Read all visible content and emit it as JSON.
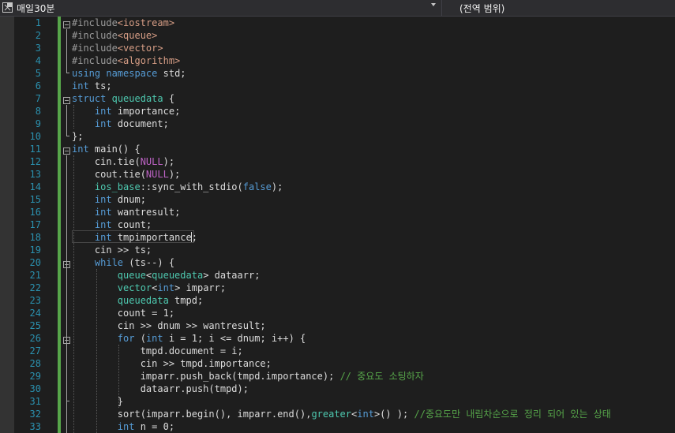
{
  "navbar": {
    "project_name": "매일30분",
    "scope_label": "(전역 범위)"
  },
  "editor": {
    "lines": [
      {
        "n": "1",
        "t": "#include<iostream>"
      },
      {
        "n": "2",
        "t": "#include<queue>"
      },
      {
        "n": "3",
        "t": "#include<vector>"
      },
      {
        "n": "4",
        "t": "#include<algorithm>"
      },
      {
        "n": "5",
        "t": "using namespace std;"
      },
      {
        "n": "6",
        "t": "int ts;"
      },
      {
        "n": "7",
        "t": "struct queuedata {"
      },
      {
        "n": "8",
        "t": "    int importance;"
      },
      {
        "n": "9",
        "t": "    int document;"
      },
      {
        "n": "10",
        "t": "};"
      },
      {
        "n": "11",
        "t": "int main() {"
      },
      {
        "n": "12",
        "t": "    cin.tie(NULL);"
      },
      {
        "n": "13",
        "t": "    cout.tie(NULL);"
      },
      {
        "n": "14",
        "t": "    ios_base::sync_with_stdio(false);"
      },
      {
        "n": "15",
        "t": "    int dnum;"
      },
      {
        "n": "16",
        "t": "    int wantresult;"
      },
      {
        "n": "17",
        "t": "    int count;"
      },
      {
        "n": "18",
        "t": "    int tmpimportance;"
      },
      {
        "n": "19",
        "t": "    cin >> ts;"
      },
      {
        "n": "20",
        "t": "    while (ts--) {"
      },
      {
        "n": "21",
        "t": "        queue<queuedata> dataarr;"
      },
      {
        "n": "22",
        "t": "        vector<int> imparr;"
      },
      {
        "n": "23",
        "t": "        queuedata tmpd;"
      },
      {
        "n": "24",
        "t": "        count = 1;"
      },
      {
        "n": "25",
        "t": "        cin >> dnum >> wantresult;"
      },
      {
        "n": "26",
        "t": "        for (int i = 1; i <= dnum; i++) {"
      },
      {
        "n": "27",
        "t": "            tmpd.document = i;"
      },
      {
        "n": "28",
        "t": "            cin >> tmpd.importance;"
      },
      {
        "n": "29",
        "t": "            imparr.push_back(tmpd.importance); // 중요도 소팅하자"
      },
      {
        "n": "30",
        "t": "            dataarr.push(tmpd);"
      },
      {
        "n": "31",
        "t": "        }"
      },
      {
        "n": "32",
        "t": "        sort(imparr.begin(), imparr.end(),greater<int>() ); //중요도만 내림차순으로 정리 되어 있는 상태"
      },
      {
        "n": "33",
        "t": "        int n = 0;"
      }
    ]
  },
  "colors": {
    "background": "#1e1e1e",
    "line_numbers": "#2b91af",
    "keyword": "#569cd6",
    "type": "#4ec9b0",
    "comment": "#57a64a",
    "include_path": "#d69d85",
    "macro": "#bd63c5",
    "change_bar": "#57a64a"
  }
}
